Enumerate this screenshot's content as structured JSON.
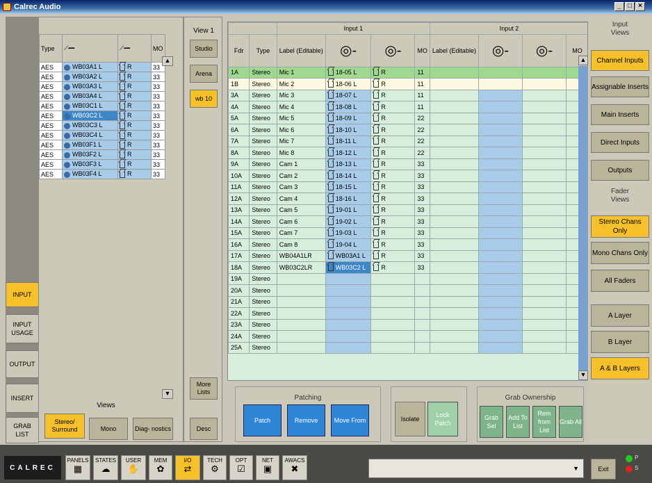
{
  "window": {
    "title": "Calrec Audio",
    "min": "_",
    "max": "□",
    "close": "×"
  },
  "nav": [
    "INPUT",
    "INPUT USAGE",
    "OUTPUT",
    "INSERT",
    "GRAB LIST"
  ],
  "source": {
    "headers": [
      "Type",
      "",
      "",
      "MO"
    ],
    "rows": [
      {
        "type": "AES",
        "name": "WB03A1 L",
        "lr": "R",
        "mo": "33"
      },
      {
        "type": "AES",
        "name": "WB03A2 L",
        "lr": "R",
        "mo": "33"
      },
      {
        "type": "AES",
        "name": "WB03A3 L",
        "lr": "R",
        "mo": "33"
      },
      {
        "type": "AES",
        "name": "WB03A4 L",
        "lr": "R",
        "mo": "33"
      },
      {
        "type": "AES",
        "name": "WB03C1 L",
        "lr": "R",
        "mo": "33"
      },
      {
        "type": "AES",
        "name": "WB03C2 L",
        "lr": "R",
        "mo": "33"
      },
      {
        "type": "AES",
        "name": "WB03C3 L",
        "lr": "R",
        "mo": "33"
      },
      {
        "type": "AES",
        "name": "WB03C4 L",
        "lr": "R",
        "mo": "33"
      },
      {
        "type": "AES",
        "name": "WB03F1 L",
        "lr": "R",
        "mo": "33"
      },
      {
        "type": "AES",
        "name": "WB03F2 L",
        "lr": "R",
        "mo": "33"
      },
      {
        "type": "AES",
        "name": "WB03F3 L",
        "lr": "R",
        "mo": "33"
      },
      {
        "type": "AES",
        "name": "WB03F4 L",
        "lr": "R",
        "mo": "33"
      }
    ],
    "views_label": "Views",
    "view_buttons": [
      "Stereo/ Surround",
      "Mono",
      "Diag- nostics"
    ]
  },
  "view_col": {
    "title": "View 1",
    "buttons": [
      "Studio",
      "Arena",
      "wb 10"
    ],
    "more": "More Lists",
    "desc": "Desc"
  },
  "grid": {
    "group1": "Input 1",
    "group2": "Input 2",
    "headers": [
      "Fdr",
      "Type",
      "Label (Editable)",
      "",
      "",
      "MO",
      "Label (Editable)",
      "",
      "",
      "MO"
    ],
    "rows": [
      [
        "1A",
        "Stereo",
        "Mic 1",
        "18-05 L",
        "R",
        "11"
      ],
      [
        "1B",
        "Stereo",
        "Mic 2",
        "18-06 L",
        "R",
        "11"
      ],
      [
        "3A",
        "Stereo",
        "Mic 3",
        "18-07 L",
        "R",
        "11"
      ],
      [
        "4A",
        "Stereo",
        "Mic 4",
        "18-08 L",
        "R",
        "11"
      ],
      [
        "5A",
        "Stereo",
        "Mic 5",
        "18-09 L",
        "R",
        "22"
      ],
      [
        "6A",
        "Stereo",
        "Mic 6",
        "18-10 L",
        "R",
        "22"
      ],
      [
        "7A",
        "Stereo",
        "Mic 7",
        "18-11 L",
        "R",
        "22"
      ],
      [
        "8A",
        "Stereo",
        "Mic 8",
        "18-12 L",
        "R",
        "22"
      ],
      [
        "9A",
        "Stereo",
        "Cam 1",
        "18-13 L",
        "R",
        "33"
      ],
      [
        "10A",
        "Stereo",
        "Cam 2",
        "18-14 L",
        "R",
        "33"
      ],
      [
        "11A",
        "Stereo",
        "Cam 3",
        "18-15 L",
        "R",
        "33"
      ],
      [
        "12A",
        "Stereo",
        "Cam 4",
        "18-16 L",
        "R",
        "33"
      ],
      [
        "13A",
        "Stereo",
        "Cam 5",
        "19-01 L",
        "R",
        "33"
      ],
      [
        "14A",
        "Stereo",
        "Cam 6",
        "19-02 L",
        "R",
        "33"
      ],
      [
        "15A",
        "Stereo",
        "Cam 7",
        "19-03 L",
        "R",
        "33"
      ],
      [
        "16A",
        "Stereo",
        "Cam 8",
        "19-04 L",
        "R",
        "33"
      ],
      [
        "17A",
        "Stereo",
        "WB04A1LR",
        "WB03A1 L",
        "R",
        "33"
      ],
      [
        "18A",
        "Stereo",
        "WB03C2LR",
        "WB03C2 L",
        "R",
        "33"
      ],
      [
        "19A",
        "Stereo",
        "",
        "",
        "",
        ""
      ],
      [
        "20A",
        "Stereo",
        "",
        "",
        "",
        ""
      ],
      [
        "21A",
        "Stereo",
        "",
        "",
        "",
        ""
      ],
      [
        "22A",
        "Stereo",
        "",
        "",
        "",
        ""
      ],
      [
        "23A",
        "Stereo",
        "",
        "",
        "",
        ""
      ],
      [
        "24A",
        "Stereo",
        "",
        "",
        "",
        ""
      ],
      [
        "25A",
        "Stereo",
        "",
        "",
        "",
        ""
      ]
    ]
  },
  "right": {
    "input_views": "Input Views",
    "input_buttons": [
      "Channel Inputs",
      "Assignable Inserts",
      "Main Inserts",
      "Direct Inputs",
      "Outputs"
    ],
    "fader_views": "Fader Views",
    "fader_buttons": [
      "Stereo Chans Only",
      "Mono Chans Only",
      "All Faders"
    ],
    "layer_buttons": [
      "A Layer",
      "B Layer",
      "A & B Layers"
    ]
  },
  "patching": {
    "title": "Patching",
    "buttons": [
      "Patch",
      "Remove",
      "Move From"
    ]
  },
  "isolate": {
    "buttons": [
      "Isolate",
      "Lock Patch"
    ]
  },
  "grab": {
    "title": "Grab Ownership",
    "buttons": [
      "Grab Sel",
      "Add To List",
      "Rem from List",
      "Grab All"
    ]
  },
  "toolbar": {
    "logo": "CALREC",
    "tools": [
      "PANELS",
      "STATES",
      "USER",
      "MEM",
      "I/O",
      "TECH",
      "OPT",
      "NET",
      "AWACS"
    ],
    "exit": "Exit",
    "leds": [
      "P",
      "S"
    ]
  }
}
